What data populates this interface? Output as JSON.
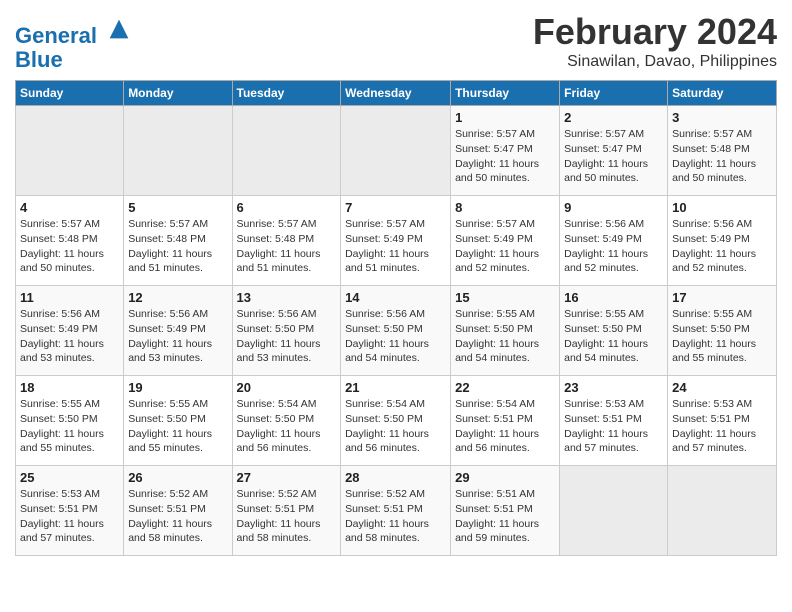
{
  "header": {
    "logo_line1": "General",
    "logo_line2": "Blue",
    "month": "February 2024",
    "location": "Sinawilan, Davao, Philippines"
  },
  "weekdays": [
    "Sunday",
    "Monday",
    "Tuesday",
    "Wednesday",
    "Thursday",
    "Friday",
    "Saturday"
  ],
  "weeks": [
    [
      {
        "day": "",
        "info": ""
      },
      {
        "day": "",
        "info": ""
      },
      {
        "day": "",
        "info": ""
      },
      {
        "day": "",
        "info": ""
      },
      {
        "day": "1",
        "info": "Sunrise: 5:57 AM\nSunset: 5:47 PM\nDaylight: 11 hours\nand 50 minutes."
      },
      {
        "day": "2",
        "info": "Sunrise: 5:57 AM\nSunset: 5:47 PM\nDaylight: 11 hours\nand 50 minutes."
      },
      {
        "day": "3",
        "info": "Sunrise: 5:57 AM\nSunset: 5:48 PM\nDaylight: 11 hours\nand 50 minutes."
      }
    ],
    [
      {
        "day": "4",
        "info": "Sunrise: 5:57 AM\nSunset: 5:48 PM\nDaylight: 11 hours\nand 50 minutes."
      },
      {
        "day": "5",
        "info": "Sunrise: 5:57 AM\nSunset: 5:48 PM\nDaylight: 11 hours\nand 51 minutes."
      },
      {
        "day": "6",
        "info": "Sunrise: 5:57 AM\nSunset: 5:48 PM\nDaylight: 11 hours\nand 51 minutes."
      },
      {
        "day": "7",
        "info": "Sunrise: 5:57 AM\nSunset: 5:49 PM\nDaylight: 11 hours\nand 51 minutes."
      },
      {
        "day": "8",
        "info": "Sunrise: 5:57 AM\nSunset: 5:49 PM\nDaylight: 11 hours\nand 52 minutes."
      },
      {
        "day": "9",
        "info": "Sunrise: 5:56 AM\nSunset: 5:49 PM\nDaylight: 11 hours\nand 52 minutes."
      },
      {
        "day": "10",
        "info": "Sunrise: 5:56 AM\nSunset: 5:49 PM\nDaylight: 11 hours\nand 52 minutes."
      }
    ],
    [
      {
        "day": "11",
        "info": "Sunrise: 5:56 AM\nSunset: 5:49 PM\nDaylight: 11 hours\nand 53 minutes."
      },
      {
        "day": "12",
        "info": "Sunrise: 5:56 AM\nSunset: 5:49 PM\nDaylight: 11 hours\nand 53 minutes."
      },
      {
        "day": "13",
        "info": "Sunrise: 5:56 AM\nSunset: 5:50 PM\nDaylight: 11 hours\nand 53 minutes."
      },
      {
        "day": "14",
        "info": "Sunrise: 5:56 AM\nSunset: 5:50 PM\nDaylight: 11 hours\nand 54 minutes."
      },
      {
        "day": "15",
        "info": "Sunrise: 5:55 AM\nSunset: 5:50 PM\nDaylight: 11 hours\nand 54 minutes."
      },
      {
        "day": "16",
        "info": "Sunrise: 5:55 AM\nSunset: 5:50 PM\nDaylight: 11 hours\nand 54 minutes."
      },
      {
        "day": "17",
        "info": "Sunrise: 5:55 AM\nSunset: 5:50 PM\nDaylight: 11 hours\nand 55 minutes."
      }
    ],
    [
      {
        "day": "18",
        "info": "Sunrise: 5:55 AM\nSunset: 5:50 PM\nDaylight: 11 hours\nand 55 minutes."
      },
      {
        "day": "19",
        "info": "Sunrise: 5:55 AM\nSunset: 5:50 PM\nDaylight: 11 hours\nand 55 minutes."
      },
      {
        "day": "20",
        "info": "Sunrise: 5:54 AM\nSunset: 5:50 PM\nDaylight: 11 hours\nand 56 minutes."
      },
      {
        "day": "21",
        "info": "Sunrise: 5:54 AM\nSunset: 5:50 PM\nDaylight: 11 hours\nand 56 minutes."
      },
      {
        "day": "22",
        "info": "Sunrise: 5:54 AM\nSunset: 5:51 PM\nDaylight: 11 hours\nand 56 minutes."
      },
      {
        "day": "23",
        "info": "Sunrise: 5:53 AM\nSunset: 5:51 PM\nDaylight: 11 hours\nand 57 minutes."
      },
      {
        "day": "24",
        "info": "Sunrise: 5:53 AM\nSunset: 5:51 PM\nDaylight: 11 hours\nand 57 minutes."
      }
    ],
    [
      {
        "day": "25",
        "info": "Sunrise: 5:53 AM\nSunset: 5:51 PM\nDaylight: 11 hours\nand 57 minutes."
      },
      {
        "day": "26",
        "info": "Sunrise: 5:52 AM\nSunset: 5:51 PM\nDaylight: 11 hours\nand 58 minutes."
      },
      {
        "day": "27",
        "info": "Sunrise: 5:52 AM\nSunset: 5:51 PM\nDaylight: 11 hours\nand 58 minutes."
      },
      {
        "day": "28",
        "info": "Sunrise: 5:52 AM\nSunset: 5:51 PM\nDaylight: 11 hours\nand 58 minutes."
      },
      {
        "day": "29",
        "info": "Sunrise: 5:51 AM\nSunset: 5:51 PM\nDaylight: 11 hours\nand 59 minutes."
      },
      {
        "day": "",
        "info": ""
      },
      {
        "day": "",
        "info": ""
      }
    ]
  ]
}
